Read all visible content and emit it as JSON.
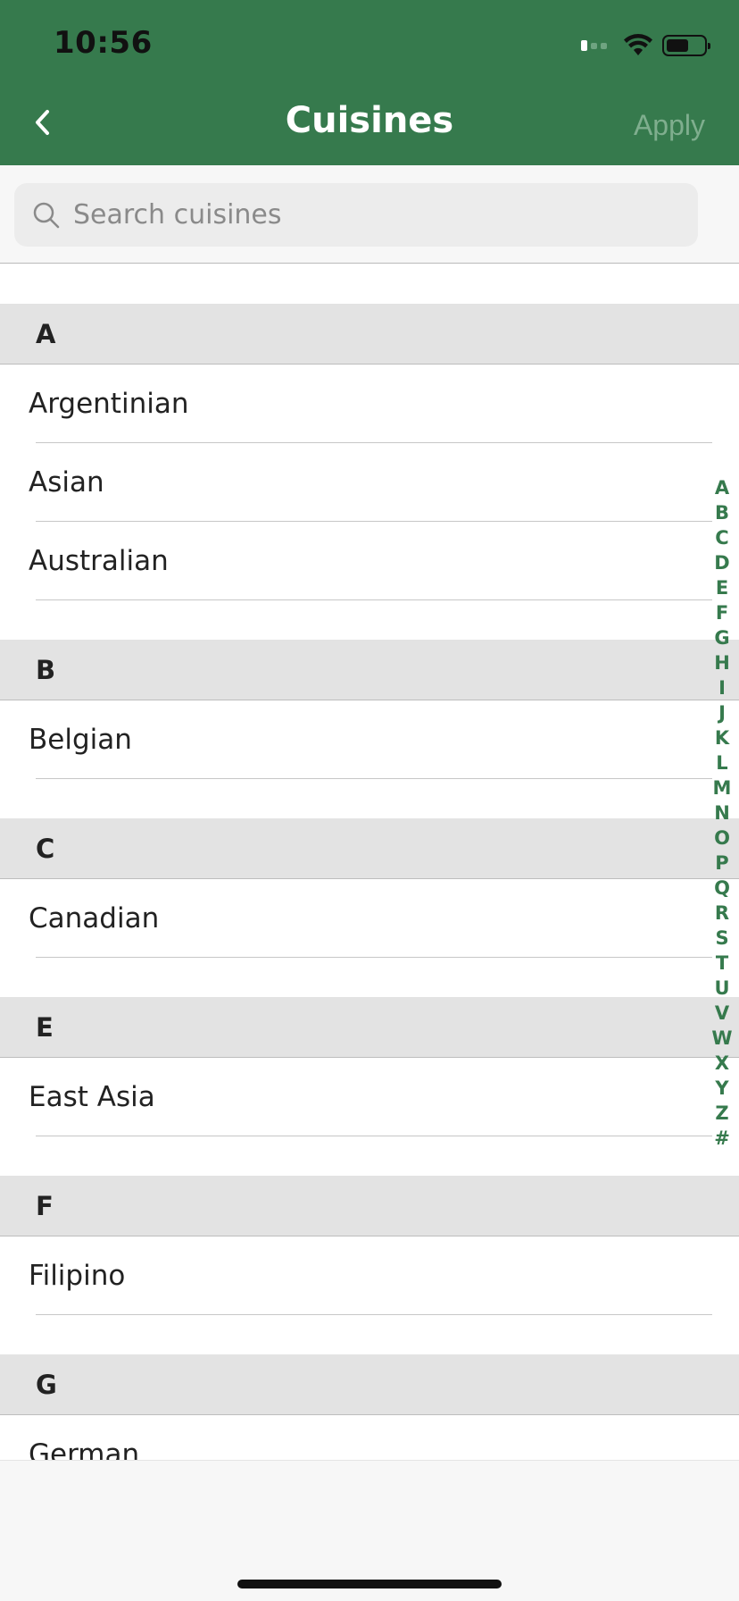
{
  "status_bar": {
    "time": "10:56"
  },
  "nav": {
    "title": "Cuisines",
    "apply_label": "Apply",
    "back_icon": "chevron-left-icon"
  },
  "search": {
    "placeholder": "Search cuisines",
    "value": ""
  },
  "sections": [
    {
      "letter": "A",
      "items": [
        "Argentinian",
        "Asian",
        "Australian"
      ]
    },
    {
      "letter": "B",
      "items": [
        "Belgian"
      ]
    },
    {
      "letter": "C",
      "items": [
        "Canadian"
      ]
    },
    {
      "letter": "E",
      "items": [
        "East Asia"
      ]
    },
    {
      "letter": "F",
      "items": [
        "Filipino"
      ]
    },
    {
      "letter": "G",
      "items": [
        "German"
      ]
    }
  ],
  "index": [
    "A",
    "B",
    "C",
    "D",
    "E",
    "F",
    "G",
    "H",
    "I",
    "J",
    "K",
    "L",
    "M",
    "N",
    "O",
    "P",
    "Q",
    "R",
    "S",
    "T",
    "U",
    "V",
    "W",
    "X",
    "Y",
    "Z",
    "#"
  ],
  "colors": {
    "header": "#367a4d",
    "accent": "#367a4d",
    "apply_disabled": "#7fae8e",
    "section_bg": "#e3e3e3"
  }
}
